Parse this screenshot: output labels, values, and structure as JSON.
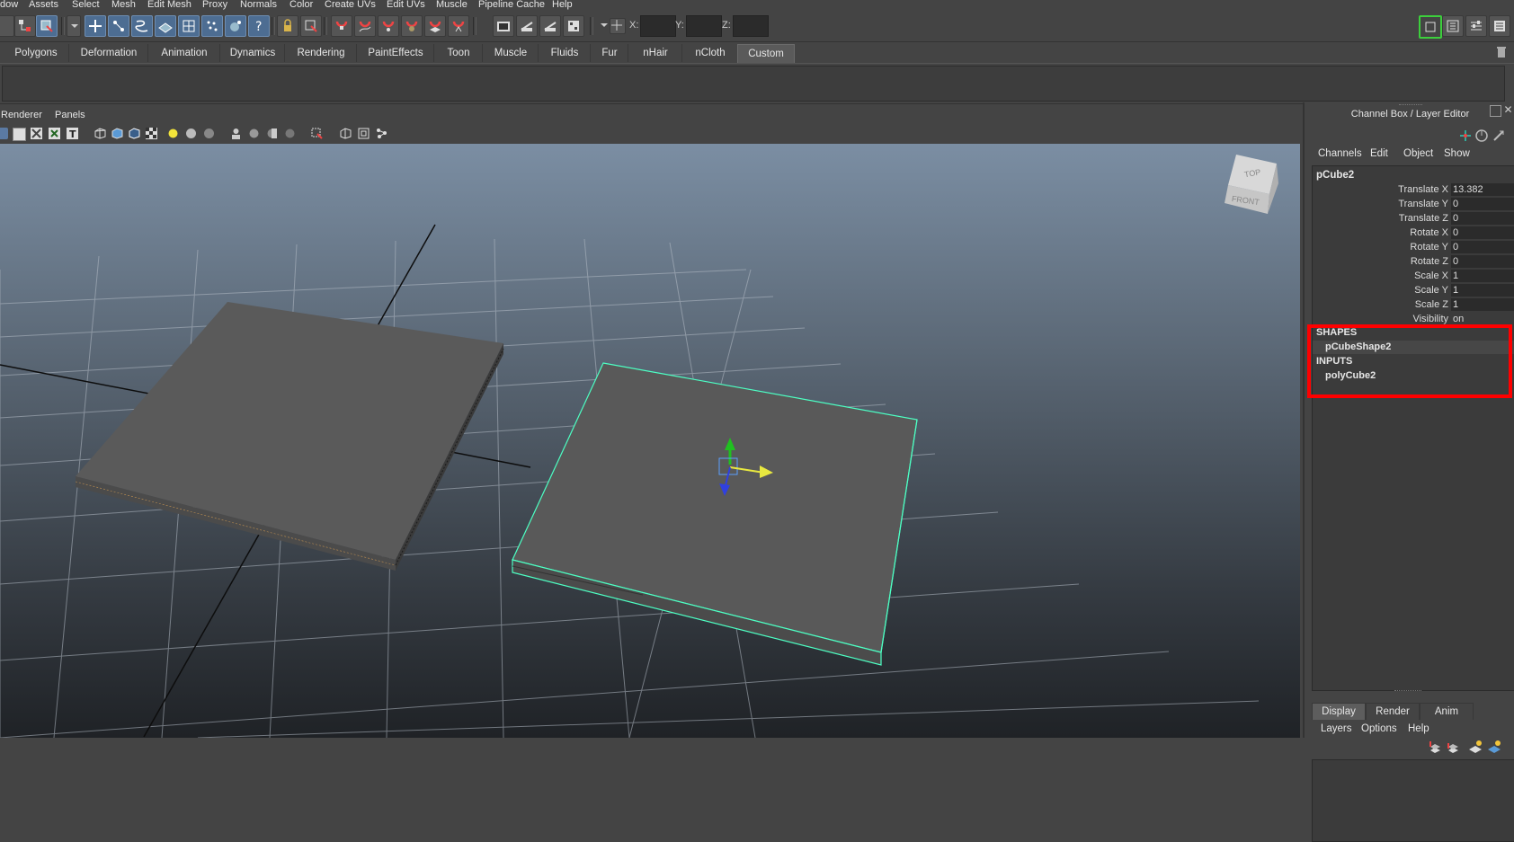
{
  "menubar": {
    "items": [
      "dow",
      "Assets",
      "Select",
      "Mesh",
      "Edit Mesh",
      "Proxy",
      "Normals",
      "Color",
      "Create UVs",
      "Edit UVs",
      "Muscle",
      "Pipeline Cache",
      "Help"
    ]
  },
  "statusline": {
    "coord_x_label": "X:",
    "coord_y_label": "Y:",
    "coord_z_label": "Z:"
  },
  "shelf": {
    "tabs": [
      "Polygons",
      "Deformation",
      "Animation",
      "Dynamics",
      "Rendering",
      "PaintEffects",
      "Toon",
      "Muscle",
      "Fluids",
      "Fur",
      "nHair",
      "nCloth",
      "Custom"
    ],
    "active_tab": "Custom"
  },
  "panel": {
    "menus": [
      "Renderer",
      "Panels"
    ],
    "viewcube_top": "TOP",
    "viewcube_front": "FRONT"
  },
  "channel_box": {
    "title": "Channel Box / Layer Editor",
    "menus": [
      "Channels",
      "Edit",
      "Object",
      "Show"
    ],
    "object_name": "pCube2",
    "channels": [
      {
        "name": "Translate X",
        "value": "13.382"
      },
      {
        "name": "Translate Y",
        "value": "0"
      },
      {
        "name": "Translate Z",
        "value": "0"
      },
      {
        "name": "Rotate X",
        "value": "0"
      },
      {
        "name": "Rotate Y",
        "value": "0"
      },
      {
        "name": "Rotate Z",
        "value": "0"
      },
      {
        "name": "Scale X",
        "value": "1"
      },
      {
        "name": "Scale Y",
        "value": "1"
      },
      {
        "name": "Scale Z",
        "value": "1"
      },
      {
        "name": "Visibility",
        "value": "on"
      }
    ],
    "shapes_header": "SHAPES",
    "shape_name": "pCubeShape2",
    "inputs_header": "INPUTS",
    "input_name": "polyCube2"
  },
  "layer_editor": {
    "tabs": [
      "Display",
      "Render",
      "Anim"
    ],
    "active_tab": "Display",
    "menus": [
      "Layers",
      "Options",
      "Help"
    ]
  },
  "colors": {
    "selection_outline": "#4dffc3",
    "highlight_box": "#ff0000",
    "active_tool_blue": "#4d6d92"
  }
}
